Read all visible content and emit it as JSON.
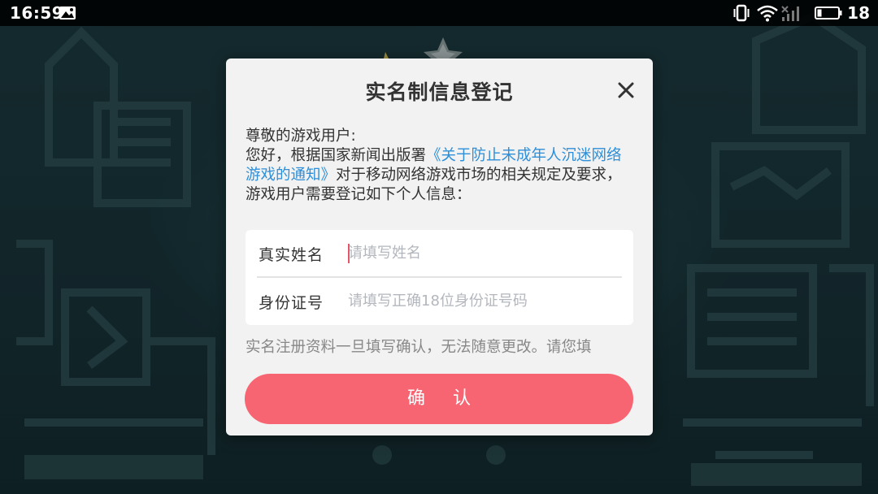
{
  "status_bar": {
    "time": "16:59",
    "battery_level": "18",
    "icons": [
      "image-icon",
      "vibrate-icon",
      "wifi-icon",
      "signal-icon",
      "battery-icon"
    ]
  },
  "dialog": {
    "title": "实名制信息登记",
    "close_icon": "close-icon",
    "greeting": "尊敬的游戏用户:",
    "notice_prefix": "您好，根据国家新闻出版署",
    "notice_link": "《关于防止未成年人沉迷网络游戏的通知》",
    "notice_suffix": "对于移动网络游戏市场的相关规定及要求，游戏用户需要登记如下个人信息：",
    "fields": {
      "name_label": "真实姓名",
      "name_placeholder": "请填写姓名",
      "id_label": "身份证号",
      "id_placeholder": "请填写正确18位身份证号码"
    },
    "warning": "实名注册资料一旦填写确认，无法随意更改。请您填",
    "confirm_label": "确认"
  },
  "colors": {
    "accent_button": "#f76572",
    "link": "#2f8fd8",
    "caret": "#e4556a",
    "background": "#152b30"
  }
}
